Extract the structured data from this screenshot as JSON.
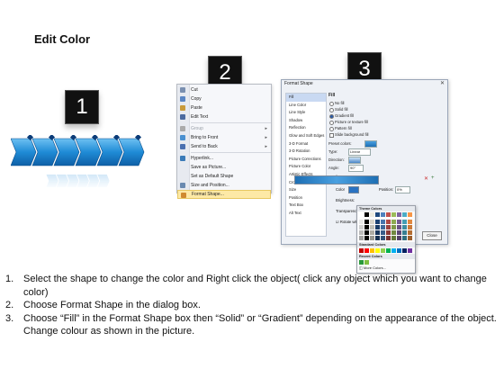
{
  "title": "Edit Color",
  "steps": {
    "s1": "1",
    "s2": "2",
    "s3": "3"
  },
  "context_menu": {
    "items": [
      {
        "label": "Cut",
        "icon": "scissors-icon"
      },
      {
        "label": "Copy",
        "icon": "copy-icon"
      },
      {
        "label": "Paste",
        "icon": "paste-icon"
      },
      {
        "label": "Edit Text",
        "icon": "text-icon"
      },
      {
        "label": "Group",
        "icon": "group-icon",
        "disabled": true
      },
      {
        "label": "Bring to Front",
        "icon": "bring-front-icon"
      },
      {
        "label": "Send to Back",
        "icon": "send-back-icon"
      },
      {
        "label": "Hyperlink...",
        "icon": "hyperlink-icon"
      },
      {
        "label": "Save as Picture...",
        "icon": ""
      },
      {
        "label": "Set as Default Shape",
        "icon": ""
      },
      {
        "label": "Size and Position...",
        "icon": "size-icon"
      },
      {
        "label": "Format Shape...",
        "icon": "format-shape-icon",
        "highlighted": true
      }
    ]
  },
  "dialog": {
    "title": "Format Shape",
    "categories": [
      "Fill",
      "Line Color",
      "Line Style",
      "Shadow",
      "Reflection",
      "Glow and Soft Edges",
      "3-D Format",
      "3-D Rotation",
      "Picture Corrections",
      "Picture Color",
      "Artistic Effects",
      "Crop",
      "Size",
      "Position",
      "Text Box",
      "Alt Text"
    ],
    "fill_heading": "Fill",
    "options": [
      "No fill",
      "Solid fill",
      "Gradient fill",
      "Picture or texture fill",
      "Pattern fill",
      "Slide background fill"
    ],
    "preset_label": "Preset colors:",
    "type_label": "Type:",
    "type_value": "Linear",
    "direction_label": "Direction:",
    "angle_label": "Angle:",
    "angle_value": "90°",
    "stops_label": "Gradient stops",
    "color_label": "Color",
    "position_label": "Position:",
    "position_value": "0%",
    "brightness_label": "Brightness:",
    "transparency_label": "Transparency:",
    "rotate_label": "Rotate with shape",
    "close_label": "Close"
  },
  "picker": {
    "theme_label": "Theme Colors",
    "standard_label": "Standard Colors",
    "recent_label": "Recent Colors",
    "more_label": "More Colors..."
  },
  "instructions": [
    {
      "n": "1.",
      "text": "Select the shape to change the color and Right click the object( click any object which you want to change color)"
    },
    {
      "n": "2.",
      "text": "Choose Format Shape in the dialog box."
    },
    {
      "n": "3.",
      "text": "Choose “Fill” in the Format Shape box then “Solid” or “Gradient” depending on the appearance of the object. Change colour as shown in the picture."
    }
  ]
}
